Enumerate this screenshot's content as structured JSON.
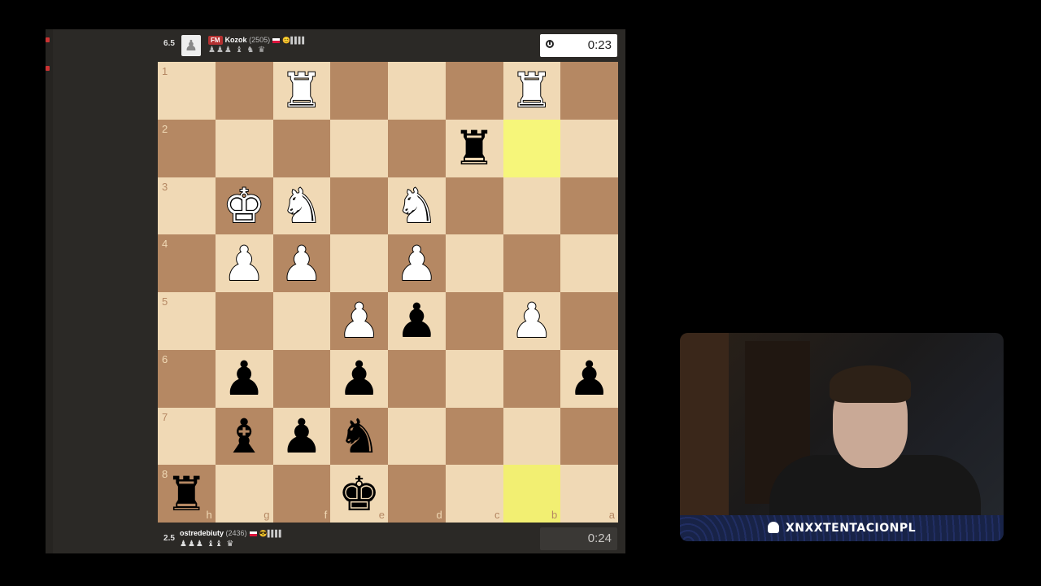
{
  "top_player": {
    "score": "6.5",
    "title": "FM",
    "name": "Kozok",
    "rating": "(2505)",
    "indicator": "😊 ▌▌▌▌",
    "captured": "♟♟♟ ♝ ♞ ♛",
    "clock": "0:23"
  },
  "bottom_player": {
    "score": "2.5",
    "name": "ostredebiuty",
    "rating": "(2436)",
    "indicator": "😎 ▌▌▌▌",
    "captured": "♟♟♟ ♝♝ ♛",
    "clock": "0:24"
  },
  "board": {
    "ranks": [
      "1",
      "2",
      "3",
      "4",
      "5",
      "6",
      "7",
      "8"
    ],
    "files": [
      "h",
      "g",
      "f",
      "e",
      "d",
      "c",
      "b",
      "a"
    ],
    "rows": [
      [
        "",
        "",
        "wr",
        "",
        "",
        "",
        "wr",
        ""
      ],
      [
        "",
        "",
        "",
        "",
        "",
        "br",
        "",
        ""
      ],
      [
        "",
        "wk",
        "wn",
        "",
        "wn",
        "",
        "",
        ""
      ],
      [
        "",
        "wp",
        "wp",
        "",
        "wp",
        "",
        "",
        ""
      ],
      [
        "",
        "",
        "",
        "wp",
        "bp",
        "",
        "wp",
        ""
      ],
      [
        "",
        "bp",
        "",
        "bp",
        "",
        "",
        "",
        "bp"
      ],
      [
        "",
        "bb",
        "bp",
        "bn",
        "",
        "",
        "",
        ""
      ],
      [
        "br",
        "",
        "",
        "bk",
        "",
        "",
        "",
        ""
      ]
    ],
    "highlights": [
      "2-6",
      "8-6"
    ]
  },
  "webcam": {
    "streamer_name": "XNXXTENTACIONPL"
  },
  "colors": {
    "light_square": "#f0d9b5",
    "dark_square": "#b58863",
    "highlight": "#f6f67a",
    "title_badge": "#b33131"
  }
}
